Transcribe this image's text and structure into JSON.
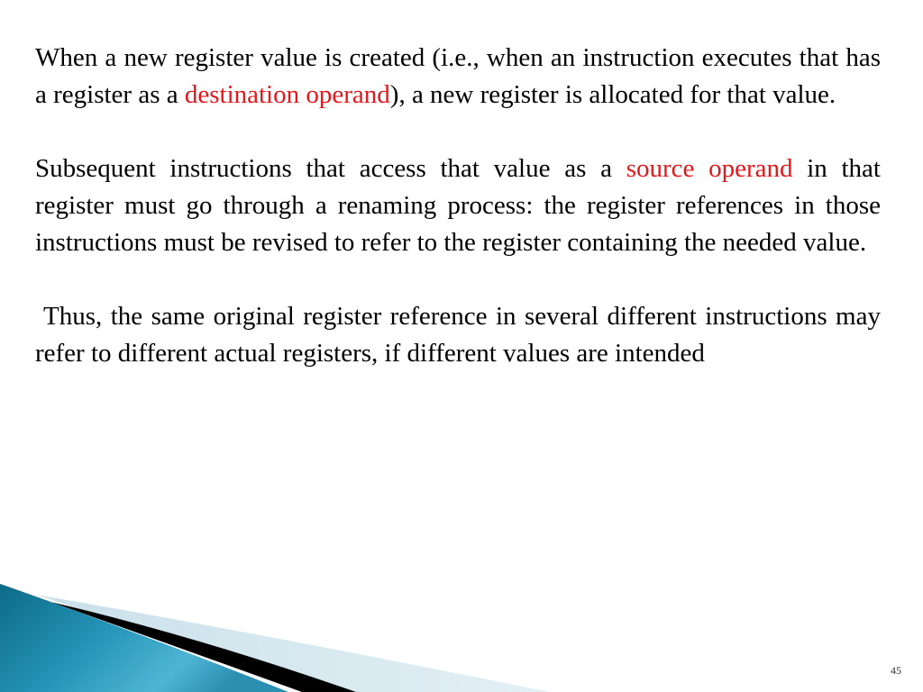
{
  "slide": {
    "paragraphs": [
      {
        "segments": [
          {
            "text": "When a new register value is created (i.e., when an instruction executes that has a register as a ",
            "highlight": false
          },
          {
            "text": "destination operand",
            "highlight": true
          },
          {
            "text": "), a new register is allocated for that value.",
            "highlight": false
          }
        ]
      },
      {
        "segments": [
          {
            "text": "Subsequent instructions that access that value as a ",
            "highlight": false
          },
          {
            "text": "source operand",
            "highlight": true
          },
          {
            "text": " in that register must go through a renaming process: the register references in those instructions must be revised to refer to the register containing the needed value.",
            "highlight": false
          }
        ]
      },
      {
        "segments": [
          {
            "text": "Thus, the same original register reference in several different instructions may refer to different actual registers, if different values are intended",
            "highlight": false
          }
        ]
      }
    ],
    "page_number": "45"
  },
  "colors": {
    "text": "#000000",
    "highlight": "#e8161b",
    "swoosh_teal_dark": "#0f6f8c",
    "swoosh_teal_light": "#4db3d3",
    "swoosh_black": "#000000",
    "swoosh_pale": "#d3e6ef"
  }
}
